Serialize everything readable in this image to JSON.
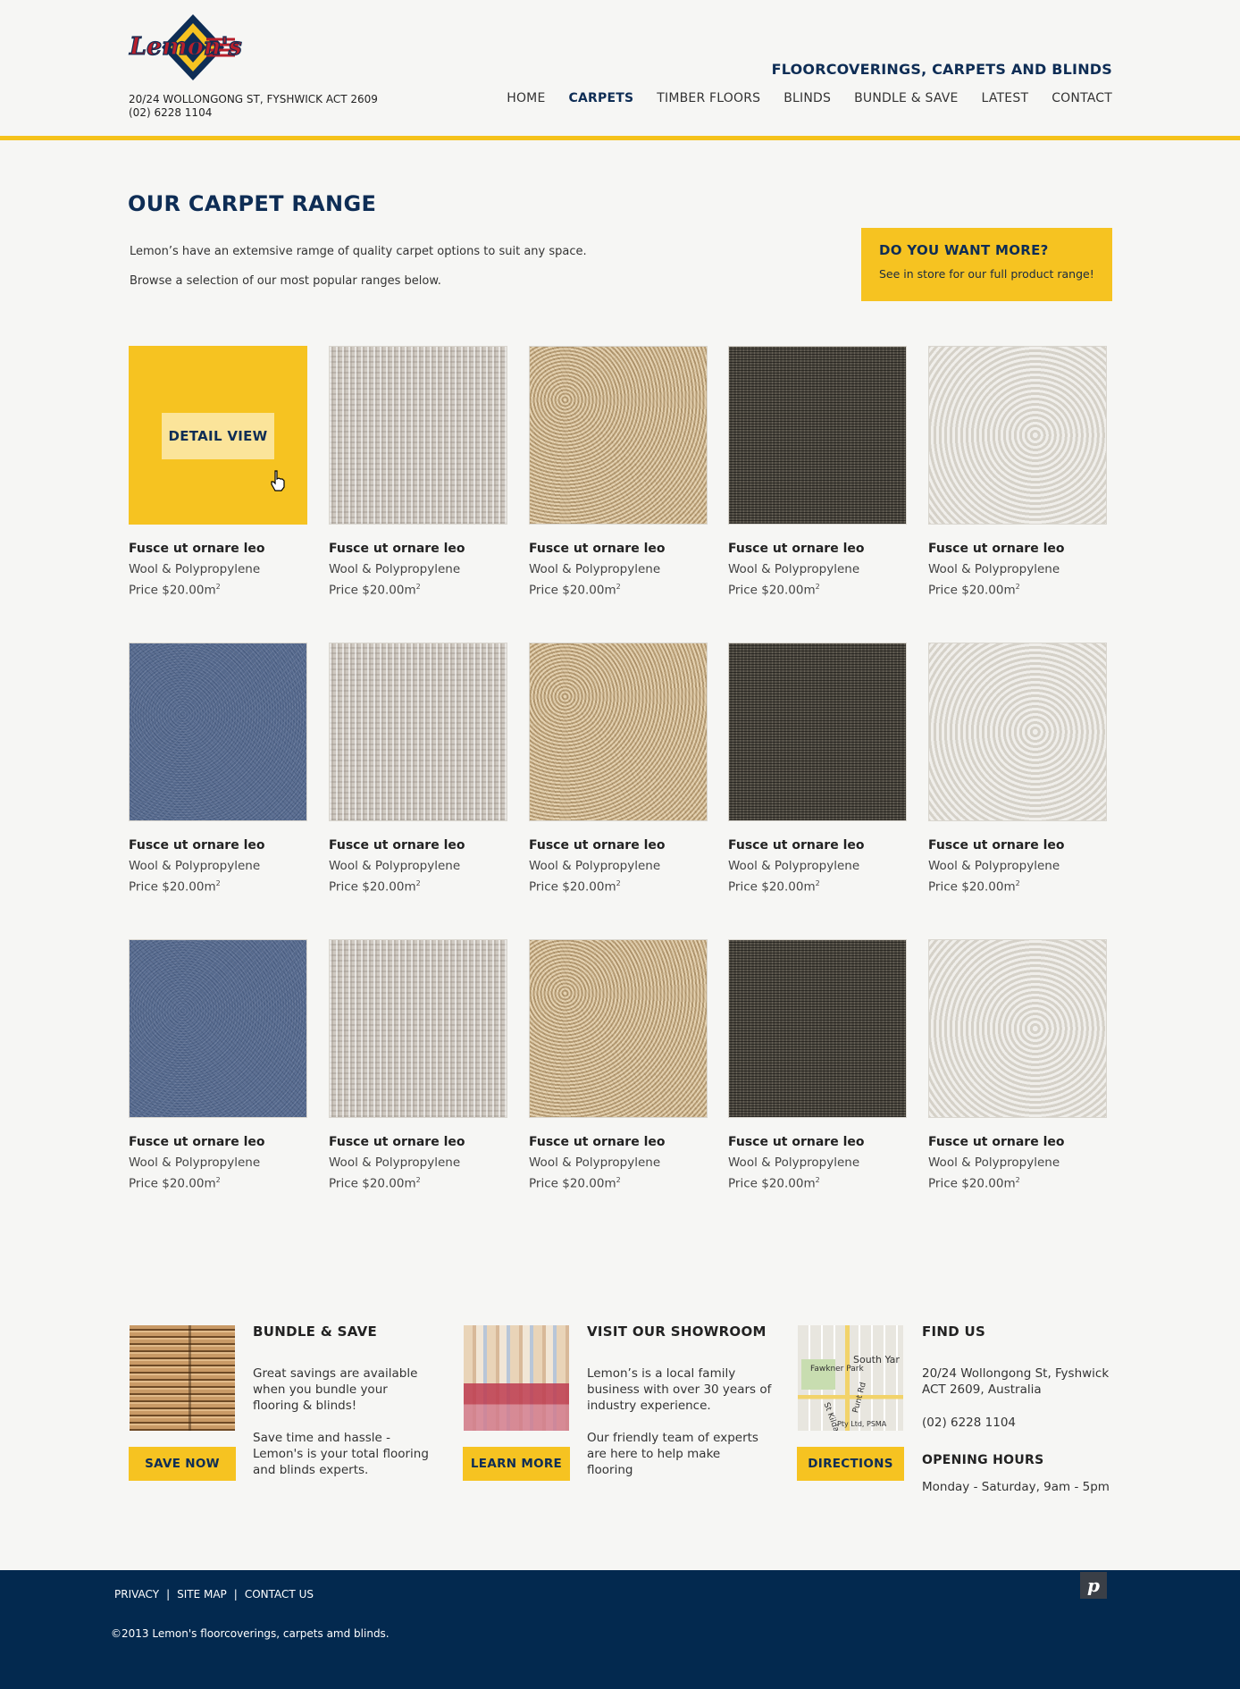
{
  "header": {
    "logo_text": "Lemon's",
    "address_line1": "20/24 WOLLONGONG ST, FYSHWICK ACT 2609",
    "address_line2": "(02) 6228 1104",
    "tagline": "FLOORCOVERINGS, CARPETS AND BLINDS",
    "nav": [
      {
        "label": "HOME",
        "active": false
      },
      {
        "label": "CARPETS",
        "active": true
      },
      {
        "label": "TIMBER FLOORS",
        "active": false
      },
      {
        "label": "BLINDS",
        "active": false
      },
      {
        "label": "BUNDLE & SAVE",
        "active": false
      },
      {
        "label": "LATEST",
        "active": false
      },
      {
        "label": "CONTACT",
        "active": false
      }
    ]
  },
  "intro": {
    "title": "OUR CARPET RANGE",
    "text1": "Lemon’s have an extemsive ramge of quality carpet options to suit any space.",
    "text2": "Browse a selection of our most popular ranges below."
  },
  "promo": {
    "title": "DO YOU WANT MORE?",
    "text": "See in store for our full product range!"
  },
  "products": {
    "detail_label": "DETAIL VIEW",
    "items": [
      {
        "name": "Fusce ut ornare leo",
        "material": "Wool & Polypropylene",
        "price": "Price $20.00m",
        "swatch": "yellow"
      },
      {
        "name": "Fusce ut ornare leo",
        "material": "Wool & Polypropylene",
        "price": "Price $20.00m",
        "swatch": "light"
      },
      {
        "name": "Fusce ut ornare leo",
        "material": "Wool & Polypropylene",
        "price": "Price $20.00m",
        "swatch": "beige"
      },
      {
        "name": "Fusce ut ornare leo",
        "material": "Wool & Polypropylene",
        "price": "Price $20.00m",
        "swatch": "dark"
      },
      {
        "name": "Fusce ut ornare leo",
        "material": "Wool & Polypropylene",
        "price": "Price $20.00m",
        "swatch": "cream"
      },
      {
        "name": "Fusce ut ornare leo",
        "material": "Wool & Polypropylene",
        "price": "Price $20.00m",
        "swatch": "blue"
      },
      {
        "name": "Fusce ut ornare leo",
        "material": "Wool & Polypropylene",
        "price": "Price $20.00m",
        "swatch": "light"
      },
      {
        "name": "Fusce ut ornare leo",
        "material": "Wool & Polypropylene",
        "price": "Price $20.00m",
        "swatch": "beige"
      },
      {
        "name": "Fusce ut ornare leo",
        "material": "Wool & Polypropylene",
        "price": "Price $20.00m",
        "swatch": "dark"
      },
      {
        "name": "Fusce ut ornare leo",
        "material": "Wool & Polypropylene",
        "price": "Price $20.00m",
        "swatch": "cream"
      },
      {
        "name": "Fusce ut ornare leo",
        "material": "Wool & Polypropylene",
        "price": "Price $20.00m",
        "swatch": "blue"
      },
      {
        "name": "Fusce ut ornare leo",
        "material": "Wool & Polypropylene",
        "price": "Price $20.00m",
        "swatch": "light"
      },
      {
        "name": "Fusce ut ornare leo",
        "material": "Wool & Polypropylene",
        "price": "Price $20.00m",
        "swatch": "beige"
      },
      {
        "name": "Fusce ut ornare leo",
        "material": "Wool & Polypropylene",
        "price": "Price $20.00m",
        "swatch": "dark"
      },
      {
        "name": "Fusce ut ornare leo",
        "material": "Wool & Polypropylene",
        "price": "Price $20.00m",
        "swatch": "cream"
      }
    ],
    "price_unit_sup": "2"
  },
  "features": {
    "bundle": {
      "title": "BUNDLE & SAVE",
      "text1": "Great savings are available when you bundle your flooring & blinds!",
      "text2": "Save time and hassle - Lemon's is your total flooring and blinds experts.",
      "button": "SAVE NOW"
    },
    "showroom": {
      "title": "VISIT OUR SHOWROOM",
      "text1": "Lemon’s is a local family business with over 30 years of industry experience.",
      "text2": "Our friendly team of experts are here to help make flooring",
      "button": "LEARN MORE"
    },
    "find": {
      "title": "FIND US",
      "address": "20/24 Wollongong St, Fyshwick ACT 2609, Australia",
      "phone": "(02) 6228 1104",
      "hours_title": "OPENING HOURS",
      "hours": "Monday - Saturday, 9am - 5pm",
      "button": "DIRECTIONS",
      "map_labels": [
        "South Yar",
        "Fawkner Park",
        "St Kilda",
        "Punt Rd",
        "Pty Ltd, PSMA"
      ]
    }
  },
  "footer": {
    "links": [
      "PRIVACY",
      "SITE MAP",
      "CONTACT US"
    ],
    "separator": "|",
    "copyright": "©2013 Lemon's floorcoverings, carpets amd blinds.",
    "badge": "p"
  },
  "colors": {
    "accent_yellow": "#f6c321",
    "navy": "#0e2d55",
    "footer_bg": "#03294f"
  }
}
